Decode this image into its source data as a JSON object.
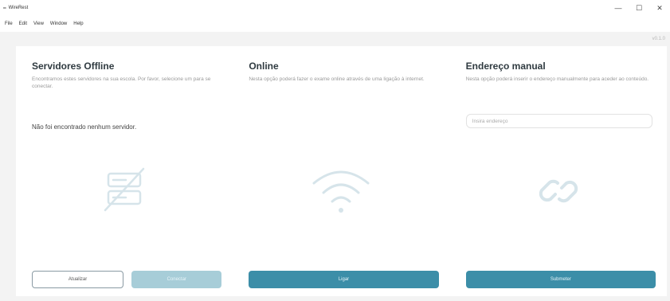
{
  "window": {
    "title": "WireRest",
    "controls": {
      "minimize": "—",
      "maximize": "☐",
      "close": "✕"
    }
  },
  "menu": [
    "File",
    "Edit",
    "View",
    "Window",
    "Help"
  ],
  "version": "v0.1.0",
  "columns": {
    "offline": {
      "title": "Servidores Offline",
      "description": "Encontramos estes servidores na sua escola. Por favor, selecione um para se conectar.",
      "status": "Não foi encontrado nenhum servidor.",
      "btn_refresh": "Atualizar",
      "btn_connect": "Conectar"
    },
    "online": {
      "title": "Online",
      "description": "Nesta opção poderá fazer o exame online através de uma ligação à internet.",
      "btn_connect": "Ligar"
    },
    "manual": {
      "title": "Endereço manual",
      "description": "Nesta opção poderá inserir o endereço manualmente para aceder ao conteúdo.",
      "input_placeholder": "Insira endereço",
      "btn_submit": "Submeter"
    }
  },
  "colors": {
    "primary": "#3c8ea8",
    "primary_disabled": "#a7cdd8",
    "illustration": "#d6e4ea"
  },
  "icons": {
    "offline": "servers-off-icon",
    "online": "wifi-icon",
    "manual": "link-icon"
  }
}
